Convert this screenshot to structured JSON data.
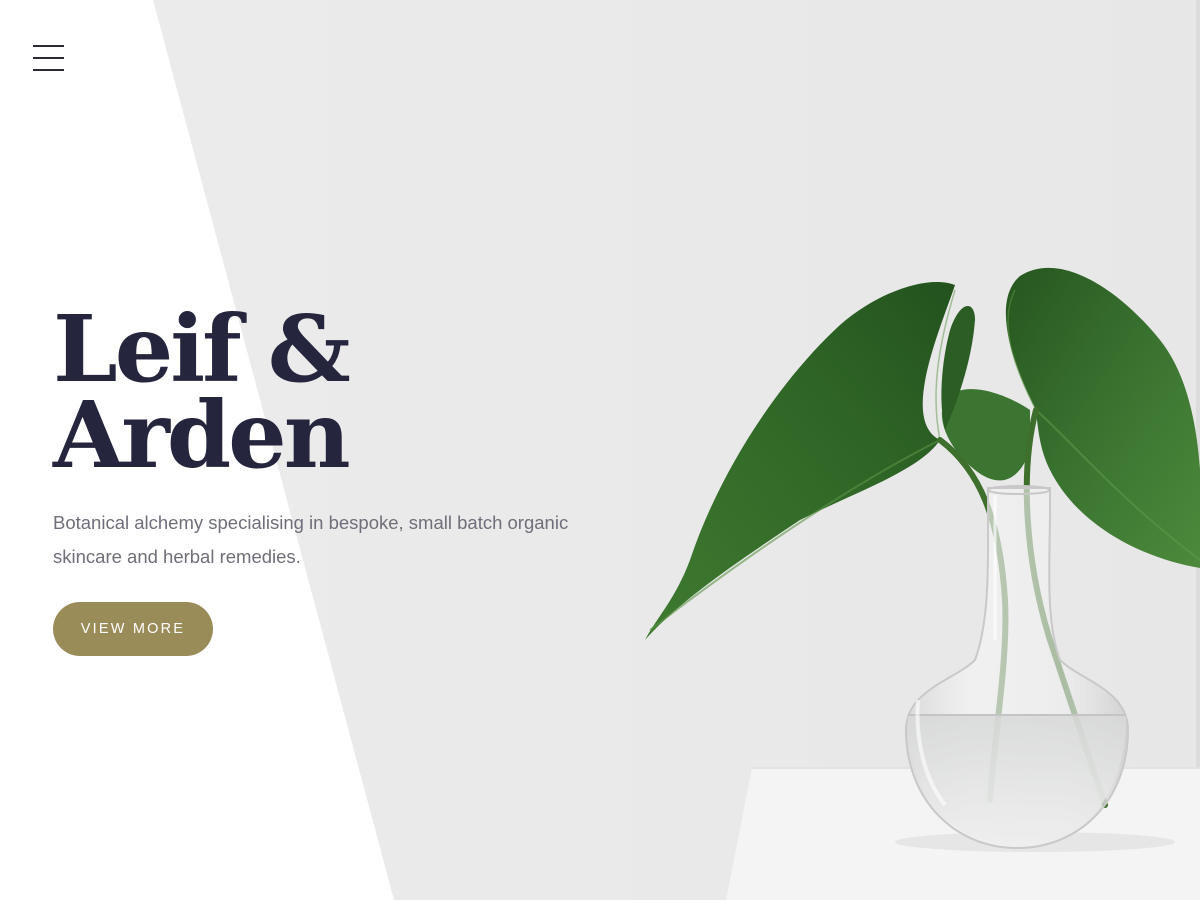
{
  "nav": {
    "menu_icon": "hamburger-menu-icon"
  },
  "hero": {
    "title_line_1": "Leif &",
    "title_line_2": "Arden",
    "tagline_line_1": "Botanical alchemy specialising in bespoke, small batch organic",
    "tagline_line_2": "skincare and herbal remedies.",
    "cta_label": "VIEW MORE",
    "image_subject": "anthurium-leaves-in-glass-vase"
  },
  "colors": {
    "title": "#25263d",
    "tagline": "#6f6e7a",
    "cta_background": "#9a8c59",
    "cta_text": "#ffffff",
    "photo_background": "#ebebeb",
    "panel": "#ffffff"
  }
}
